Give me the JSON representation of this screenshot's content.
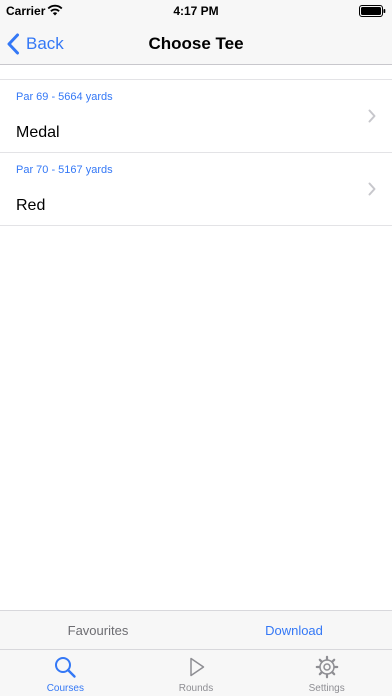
{
  "status_bar": {
    "carrier": "Carrier",
    "time": "4:17 PM"
  },
  "nav": {
    "back_label": "Back",
    "title": "Choose Tee"
  },
  "tees": [
    {
      "detail": "Par 69 - 5664 yards",
      "name": "Medal"
    },
    {
      "detail": "Par 70 - 5167 yards",
      "name": "Red"
    }
  ],
  "segments": {
    "favourites_label": "Favourites",
    "download_label": "Download"
  },
  "tabs": [
    {
      "label": "Courses",
      "icon": "search-icon",
      "active": true
    },
    {
      "label": "Rounds",
      "icon": "play-icon",
      "active": false
    },
    {
      "label": "Settings",
      "icon": "gear-icon",
      "active": false
    }
  ],
  "colors": {
    "accent": "#3478f6",
    "inactive": "#8e8e93",
    "bar_background": "#f7f7f7"
  }
}
